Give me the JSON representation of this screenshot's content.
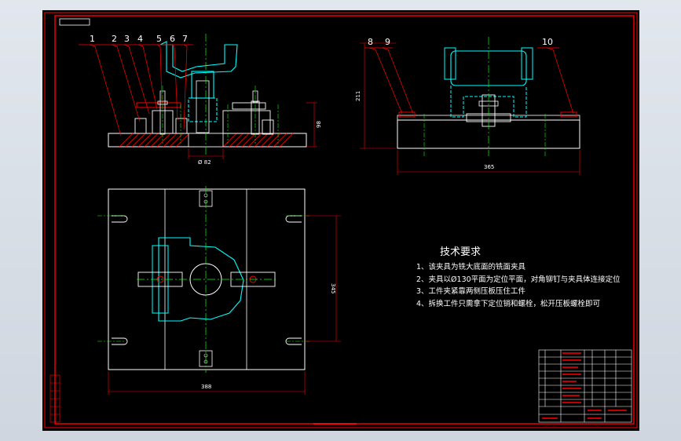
{
  "drawing": {
    "part_balloons": [
      "1",
      "2",
      "3",
      "4",
      "5",
      "6",
      "7",
      "8",
      "9",
      "10"
    ],
    "dimensions": {
      "front_bore": "Ø 82",
      "front_height": "98",
      "side_height": "211",
      "side_width": "365",
      "plan_height": "345",
      "plan_width": "388"
    },
    "notes": {
      "title": "技术要求",
      "items": [
        "1、该夹具为铣大底面的铣面夹具",
        "2、夹具以Ø130平面为定位平面，对角铆钉与夹具体连接定位",
        "3、工件夹紧靠两侧压板压住工件",
        "4、拆换工件只需拿下定位销和螺栓，松开压板螺栓即可"
      ]
    }
  },
  "colors": {
    "background": "#000000",
    "frame": "#ff0000",
    "part": "#ffffff",
    "center_line": "#00ff00",
    "workpiece": "#00ffff",
    "hatch": "#ff0000",
    "dimension": "#ff0000"
  }
}
